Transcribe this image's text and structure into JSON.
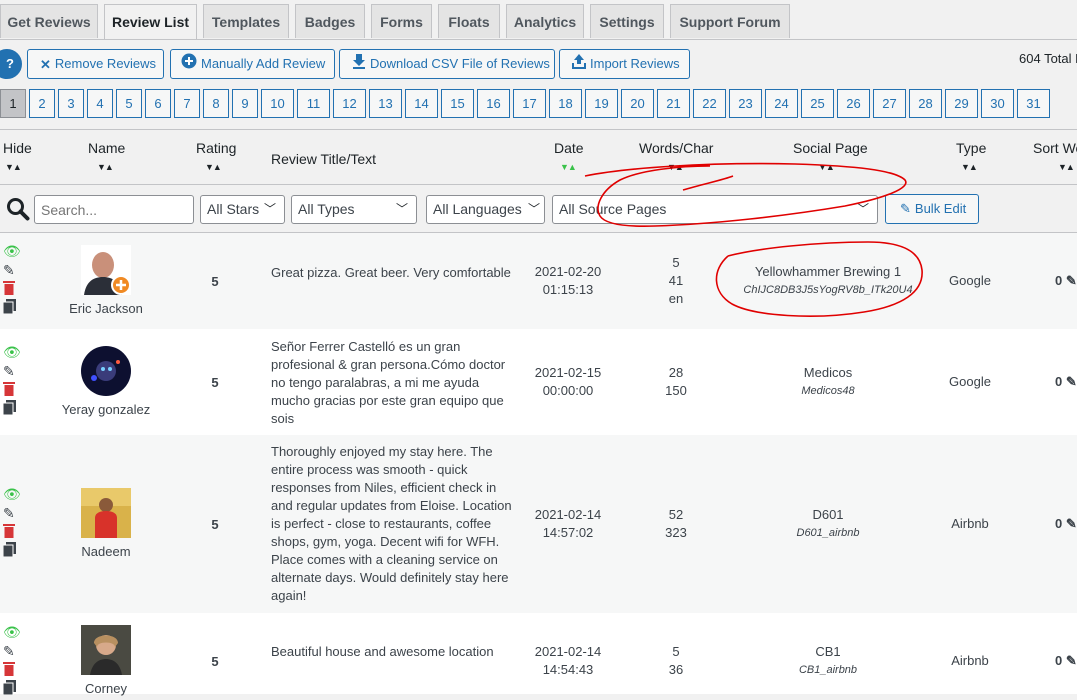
{
  "tabs": [
    "Get Reviews",
    "Review List",
    "Templates",
    "Badges",
    "Forms",
    "Floats",
    "Analytics",
    "Settings",
    "Support Forum"
  ],
  "toolbar": {
    "help_glyph": "?",
    "remove_label": "Remove Reviews",
    "add_label": "Manually Add Review",
    "download_label": "Download CSV File of Reviews",
    "import_label": "Import Reviews",
    "total_text": "604 Total R"
  },
  "pagination": [
    "1",
    "2",
    "3",
    "4",
    "5",
    "6",
    "7",
    "8",
    "9",
    "10",
    "11",
    "12",
    "13",
    "14",
    "15",
    "16",
    "17",
    "18",
    "19",
    "20",
    "21",
    "22",
    "23",
    "24",
    "25",
    "26",
    "27",
    "28",
    "29",
    "30",
    "31"
  ],
  "columns": {
    "hide": "Hide",
    "name": "Name",
    "rating": "Rating",
    "text": "Review Title/Text",
    "date": "Date",
    "words": "Words/Char",
    "social": "Social Page",
    "type": "Type",
    "sort": "Sort We"
  },
  "filters": {
    "search_placeholder": "Search...",
    "stars": "All Stars",
    "types": "All Types",
    "languages": "All Languages",
    "source": "All Source Pages",
    "bulk_edit": "Bulk Edit"
  },
  "reviews": [
    {
      "name": "Eric Jackson",
      "rating": "5",
      "text": "Great pizza. Great beer. Very comfortable",
      "date": "2021-02-20",
      "time": "01:15:13",
      "words": "5",
      "chars": "41",
      "lang": "en",
      "page_name": "Yellowhammer Brewing 1",
      "page_id": "ChIJC8DB3J5sYogRV8b_ITk20U4",
      "type": "Google",
      "sort_weight": "0"
    },
    {
      "name": "Yeray gonzalez",
      "rating": "5",
      "text": "Señor Ferrer Castelló es un gran profesional & gran persona.Cómo doctor no tengo paralabras, a mi me ayuda mucho gracias por este gran equipo que sois",
      "date": "2021-02-15",
      "time": "00:00:00",
      "words": "28",
      "chars": "150",
      "lang": "",
      "page_name": "Medicos",
      "page_id": "Medicos48",
      "type": "Google",
      "sort_weight": "0"
    },
    {
      "name": "Nadeem",
      "rating": "5",
      "text": "Thoroughly enjoyed my stay here. The entire process was smooth - quick responses from Niles, efficient check in and regular updates from Eloise. Location is perfect - close to restaurants, coffee shops, gym, yoga. Decent wifi for WFH. Place comes with a cleaning service on alternate days. Would definitely stay here again!",
      "date": "2021-02-14",
      "time": "14:57:02",
      "words": "52",
      "chars": "323",
      "lang": "",
      "page_name": "D601",
      "page_id": "D601_airbnb",
      "type": "Airbnb",
      "sort_weight": "0"
    },
    {
      "name": "Corney",
      "rating": "5",
      "text": "Beautiful house and awesome location",
      "date": "2021-02-14",
      "time": "14:54:43",
      "words": "5",
      "chars": "36",
      "lang": "",
      "page_name": "CB1",
      "page_id": "CB1_airbnb",
      "type": "Airbnb",
      "sort_weight": "0"
    }
  ],
  "colors": {
    "accent": "#2271b1",
    "visible_eye": "#3ac24a",
    "delete": "#d63638",
    "annotation": "#e00000"
  }
}
